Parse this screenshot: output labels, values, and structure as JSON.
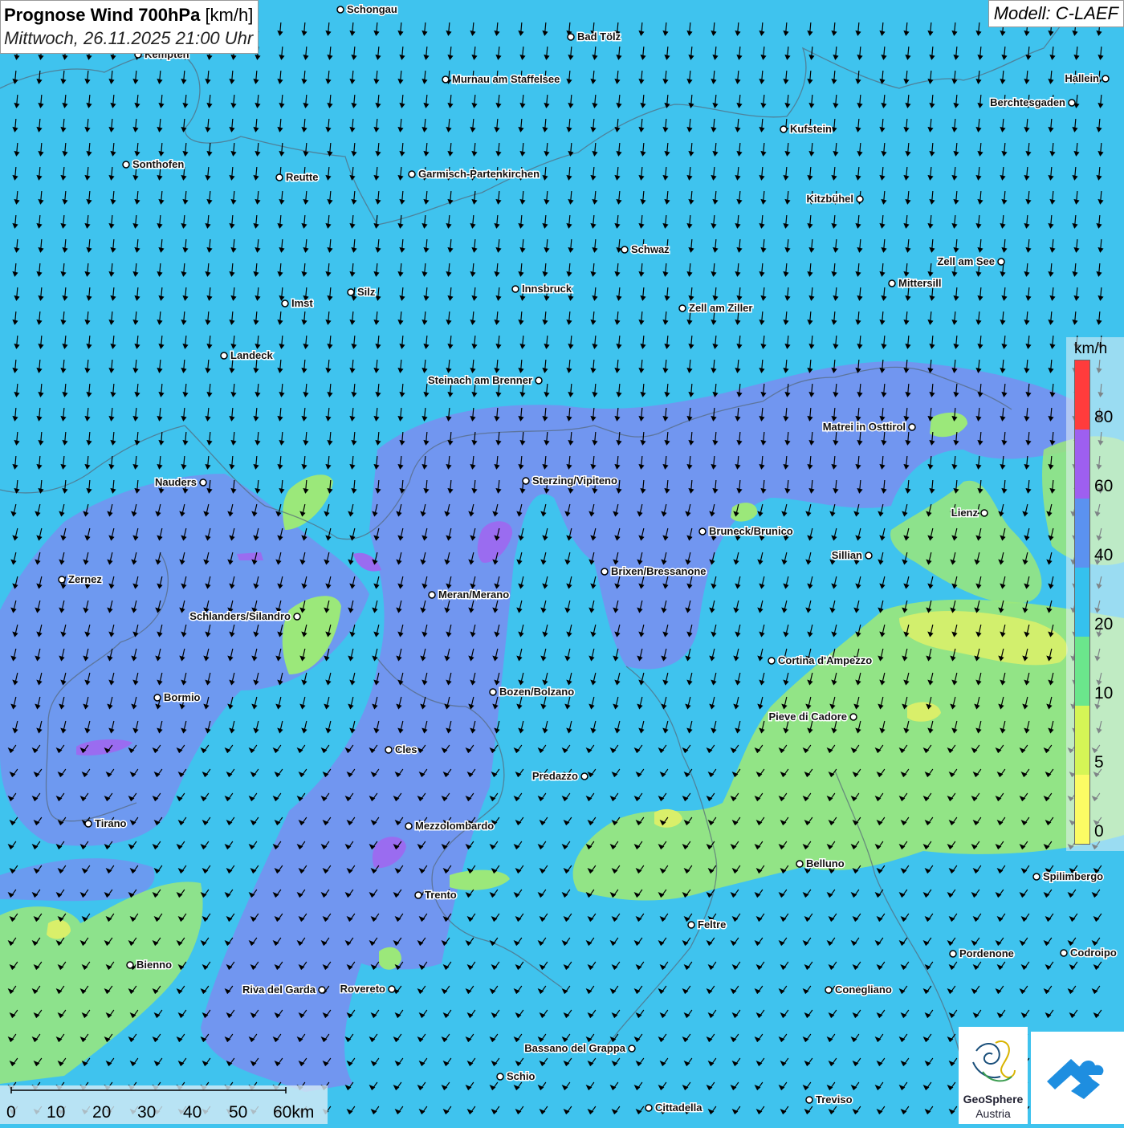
{
  "title": {
    "bold": "Prognose Wind 700hPa",
    "unit": "[km/h]",
    "datetime": "Mittwoch, 26.11.2025 21:00 Uhr"
  },
  "model": "Modell: C-LAEF",
  "legend": {
    "unit": "km/h",
    "labels": [
      "80",
      "60",
      "40",
      "20",
      "10",
      "5",
      "0"
    ],
    "colors": [
      "#ff3c3c",
      "#9e5ff0",
      "#5b92f0",
      "#35c1ee",
      "#6be68c",
      "#d5f556",
      "#fbfb64"
    ]
  },
  "scale_bar": {
    "labels": [
      "0",
      "10",
      "20",
      "30",
      "40",
      "50",
      "60km"
    ]
  },
  "logo": {
    "name_line1": "GeoSphere",
    "name_line2": "Austria"
  },
  "background_colors": {
    "base": "#3fc3ee",
    "moderate": "#7a8ef0",
    "strong": "#9a6cf0",
    "calm": "#9be87a",
    "weak": "#d9ef6a"
  },
  "wind_direction": "north-northeast, arrows pointing south-southwest",
  "cities": [
    {
      "name": "Schongau"
    },
    {
      "name": "Bad Tölz"
    },
    {
      "name": "Kempten"
    },
    {
      "name": "Murnau am Staffelsee"
    },
    {
      "name": "Hallein"
    },
    {
      "name": "Berchtesgaden"
    },
    {
      "name": "Kufstein"
    },
    {
      "name": "Sonthofen"
    },
    {
      "name": "Reutte"
    },
    {
      "name": "Garmisch-Partenkirchen"
    },
    {
      "name": "Kitzbühel"
    },
    {
      "name": "Schwaz"
    },
    {
      "name": "Zell am See"
    },
    {
      "name": "Mittersill"
    },
    {
      "name": "Silz"
    },
    {
      "name": "Innsbruck"
    },
    {
      "name": "Imst"
    },
    {
      "name": "Zell am Ziller"
    },
    {
      "name": "Landeck"
    },
    {
      "name": "Steinach am Brenner"
    },
    {
      "name": "Matrei in Osttirol"
    },
    {
      "name": "Nauders"
    },
    {
      "name": "Sterzing/Vipiteno"
    },
    {
      "name": "Lienz"
    },
    {
      "name": "Bruneck/Brunico"
    },
    {
      "name": "Sillian"
    },
    {
      "name": "Brixen/Bressanone"
    },
    {
      "name": "Zernez"
    },
    {
      "name": "Meran/Merano"
    },
    {
      "name": "Schlanders/Silandro"
    },
    {
      "name": "Cortina d'Ampezzo"
    },
    {
      "name": "Bozen/Bolzano"
    },
    {
      "name": "Bormio"
    },
    {
      "name": "Pieve di Cadore"
    },
    {
      "name": "Cles"
    },
    {
      "name": "Predazzo"
    },
    {
      "name": "Tirano"
    },
    {
      "name": "Mezzolombardo"
    },
    {
      "name": "Belluno"
    },
    {
      "name": "Spilimbergo"
    },
    {
      "name": "Trento"
    },
    {
      "name": "Feltre"
    },
    {
      "name": "Pordenone"
    },
    {
      "name": "Codroipo"
    },
    {
      "name": "Bienno"
    },
    {
      "name": "Riva del Garda"
    },
    {
      "name": "Rovereto"
    },
    {
      "name": "Conegliano"
    },
    {
      "name": "Bassano del Grappa"
    },
    {
      "name": "Schio"
    },
    {
      "name": "Cittadella"
    },
    {
      "name": "Treviso"
    }
  ]
}
